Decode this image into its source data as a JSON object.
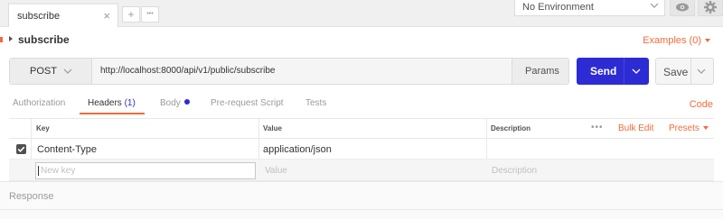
{
  "tabs": {
    "active_tab_label": "subscribe",
    "close_glyph": "×",
    "new_tab_glyph": "+",
    "more_glyph": "•••"
  },
  "environment": {
    "selected": "No Environment",
    "icons": [
      "eye-icon",
      "gear-icon"
    ]
  },
  "request": {
    "name": "subscribe",
    "examples_label": "Examples (0)",
    "method": "POST",
    "url": "http://localhost:8000/api/v1/public/subscribe",
    "params_label": "Params",
    "send_label": "Send",
    "save_label": "Save"
  },
  "subtabs": {
    "authorization": "Authorization",
    "headers_label": "Headers",
    "headers_count": "(1)",
    "body": "Body",
    "pre_request": "Pre-request Script",
    "tests": "Tests",
    "code": "Code"
  },
  "headers_table": {
    "columns": {
      "key": "Key",
      "value": "Value",
      "description": "Description"
    },
    "more_glyph": "•••",
    "bulk_edit": "Bulk Edit",
    "presets": "Presets",
    "rows": [
      {
        "checked": true,
        "key": "Content-Type",
        "value": "application/json",
        "description": ""
      }
    ],
    "new_row": {
      "key_placeholder": "New key",
      "value_placeholder": "Value",
      "description_placeholder": "Description"
    }
  },
  "response": {
    "label": "Response"
  },
  "colors": {
    "accent_orange": "#f26b3a",
    "send_blue": "#2d2bd4"
  }
}
